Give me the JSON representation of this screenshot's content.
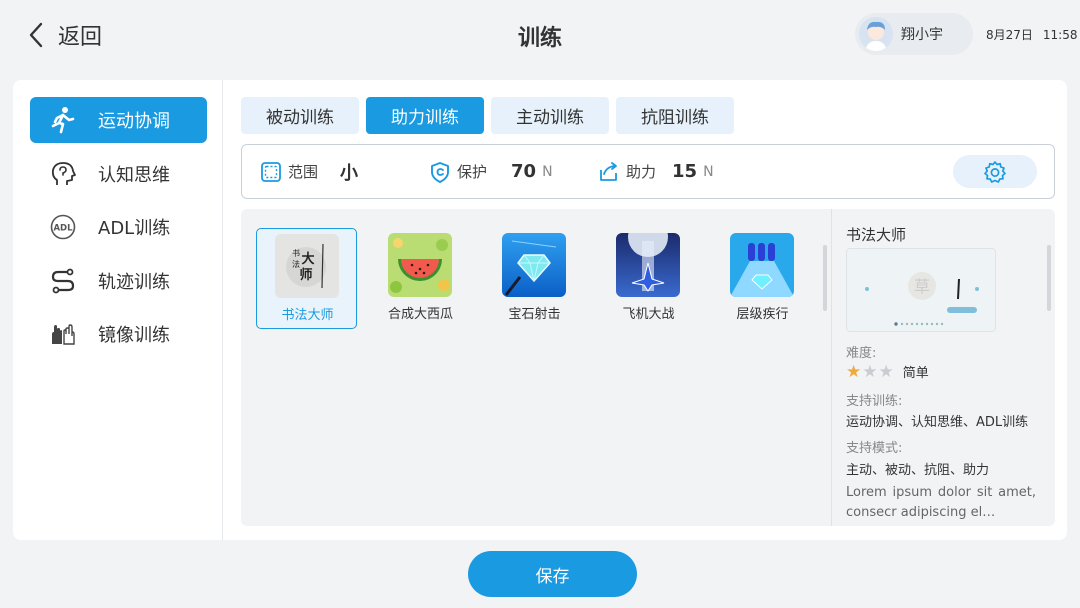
{
  "header": {
    "back_label": "返回",
    "title": "训练",
    "user_name": "翔小宇",
    "date": "8月27日",
    "time": "11:58"
  },
  "sidebar": {
    "items": [
      {
        "label": "运动协调",
        "icon": "running-person-icon",
        "active": true
      },
      {
        "label": "认知思维",
        "icon": "brain-head-icon",
        "active": false
      },
      {
        "label": "ADL训练",
        "icon": "adl-icon",
        "active": false
      },
      {
        "label": "轨迹训练",
        "icon": "trajectory-path-icon",
        "active": false
      },
      {
        "label": "镜像训练",
        "icon": "mirror-hands-icon",
        "active": false
      }
    ]
  },
  "tabs": [
    {
      "label": "被动训练",
      "active": false
    },
    {
      "label": "助力训练",
      "active": true
    },
    {
      "label": "主动训练",
      "active": false
    },
    {
      "label": "抗阻训练",
      "active": false
    }
  ],
  "settings": {
    "range": {
      "label": "范围",
      "value": "小",
      "icon": "range-frame-icon"
    },
    "protect": {
      "label": "保护",
      "value": "70",
      "unit": "N",
      "icon": "shield-icon"
    },
    "assist": {
      "label": "助力",
      "value": "15",
      "unit": "N",
      "icon": "assist-arrow-icon"
    },
    "gear_icon": "gear-icon"
  },
  "games": [
    {
      "name": "书法大师",
      "selected": true
    },
    {
      "name": "合成大西瓜",
      "selected": false
    },
    {
      "name": "宝石射击",
      "selected": false
    },
    {
      "name": "飞机大战",
      "selected": false
    },
    {
      "name": "层级疾行",
      "selected": false
    }
  ],
  "detail": {
    "title": "书法大师",
    "difficulty_label": "难度:",
    "difficulty_stars": 1,
    "difficulty_max": 3,
    "difficulty_text": "简单",
    "support_training_label": "支持训练:",
    "support_training": "运动协调、认知思维、ADL训练",
    "support_mode_label": "支持模式:",
    "support_mode": "主动、被动、抗阻、助力",
    "description": "Lorem ipsum dolor sit amet, consecr adipiscing el…"
  },
  "save_label": "保存",
  "colors": {
    "accent": "#1a9ae0",
    "tab_bg": "#e6f1fb",
    "star_on": "#f2a93b",
    "star_off": "#c9ccd1"
  }
}
